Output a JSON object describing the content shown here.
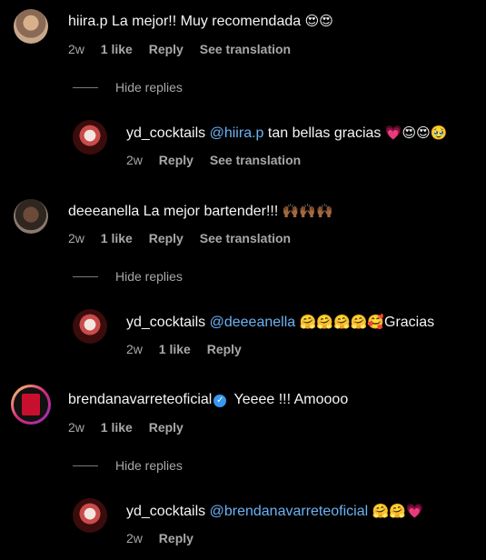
{
  "comments": [
    {
      "username": "hiira.p",
      "text": "La mejor!! Muy recomendada",
      "emojis": "😍😍",
      "time": "2w",
      "likes": "1 like",
      "reply": "Reply",
      "translate": "See translation",
      "hide_replies": "Hide replies",
      "reply_item": {
        "username": "yd_cocktails",
        "mention": "@hiira.p",
        "text": "tan bellas gracias",
        "emojis": "💗😍😍🥹",
        "time": "2w",
        "reply": "Reply",
        "translate": "See translation"
      }
    },
    {
      "username": "deeeanella",
      "text": "La mejor bartender!!!",
      "emojis": "🙌🏾🙌🏾🙌🏾",
      "time": "2w",
      "likes": "1 like",
      "reply": "Reply",
      "translate": "See translation",
      "hide_replies": "Hide replies",
      "reply_item": {
        "username": "yd_cocktails",
        "mention": "@deeeanella",
        "emojis": "🤗🤗🤗🤗🥰",
        "text": "Gracias",
        "time": "2w",
        "likes": "1 like",
        "reply": "Reply"
      }
    },
    {
      "username": "brendanavarreteoficial",
      "verified": "✓",
      "text": "Yeeee !!! Amoooo",
      "time": "2w",
      "likes": "1 like",
      "reply": "Reply",
      "hide_replies": "Hide replies",
      "reply_item": {
        "username": "yd_cocktails",
        "mention": "@brendanavarreteoficial",
        "emojis": "🤗🤗💗",
        "time": "2w",
        "reply": "Reply"
      }
    }
  ],
  "colors": {
    "mention": "#6cb2f5",
    "muted": "#a8a8a8",
    "verified": "#3897f0",
    "background": "#000000"
  }
}
